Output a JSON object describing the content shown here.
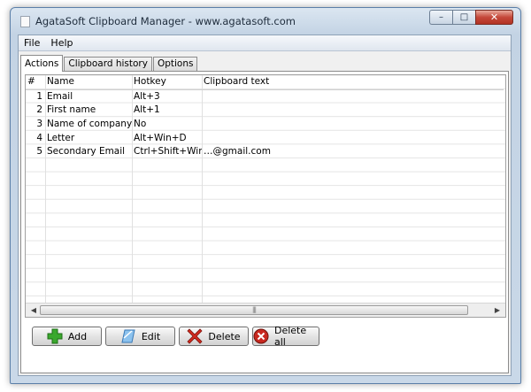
{
  "window": {
    "title": "AgataSoft Clipboard Manager - www.agatasoft.com",
    "caption_buttons": {
      "minimize": "–",
      "maximize": "□",
      "close": "✕"
    }
  },
  "menu": {
    "items": [
      "File",
      "Help"
    ]
  },
  "tabs": [
    {
      "label": "Actions",
      "active": true
    },
    {
      "label": "Clipboard history",
      "active": false
    },
    {
      "label": "Options",
      "active": false
    }
  ],
  "table": {
    "columns": [
      "#",
      "Name",
      "Hotkey",
      "Clipboard text"
    ],
    "rows": [
      {
        "num": "1",
        "name": "Email",
        "hotkey": "Alt+3",
        "text": ""
      },
      {
        "num": "2",
        "name": "First name",
        "hotkey": "Alt+1",
        "text": ""
      },
      {
        "num": "3",
        "name": "Name of company",
        "hotkey": "No",
        "text": ""
      },
      {
        "num": "4",
        "name": "Letter",
        "hotkey": "Alt+Win+D",
        "text": ""
      },
      {
        "num": "5",
        "name": "Secondary Email",
        "hotkey": "Ctrl+Shift+Win+X",
        "text": "…@gmail.com"
      }
    ],
    "scroll_grip": "|||"
  },
  "buttons": {
    "add": "Add",
    "edit": "Edit",
    "delete": "Delete",
    "delete_all": "Delete all"
  },
  "icons": {
    "add": "plus-icon",
    "edit": "edit-icon",
    "delete": "x-icon",
    "delete_all": "stop-icon"
  },
  "colors": {
    "add_icon": "#3aa82d",
    "edit_icon": "#5a9fd8",
    "delete_icon": "#d22a1e",
    "delete_all_icon": "#c8281f"
  }
}
